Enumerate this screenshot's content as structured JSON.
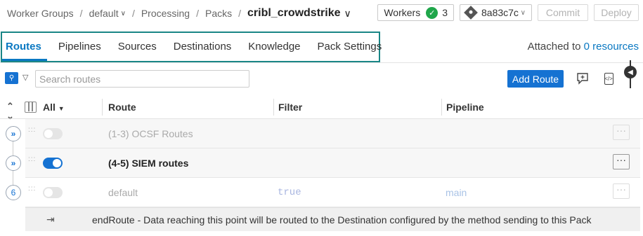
{
  "breadcrumb": {
    "items": [
      "Worker Groups",
      "default",
      "Processing",
      "Packs"
    ],
    "current": "cribl_crowdstrike",
    "separator": "/"
  },
  "header": {
    "workers_label": "Workers",
    "workers_count": "3",
    "commit_hash": "8a83c7c",
    "commit_button": "Commit",
    "deploy_button": "Deploy"
  },
  "tabs": [
    {
      "label": "Routes",
      "active": true
    },
    {
      "label": "Pipelines"
    },
    {
      "label": "Sources"
    },
    {
      "label": "Destinations"
    },
    {
      "label": "Knowledge"
    },
    {
      "label": "Pack Settings"
    }
  ],
  "attached": {
    "prefix": "Attached to",
    "link": "0 resources"
  },
  "search": {
    "placeholder": "Search routes"
  },
  "toolbar": {
    "add_route": "Add Route"
  },
  "table": {
    "headers": {
      "all": "All",
      "route": "Route",
      "filter": "Filter",
      "pipeline": "Pipeline"
    },
    "rows": [
      {
        "name": "(1-3) OCSF Routes",
        "enabled": false,
        "filter": "",
        "pipeline": "",
        "node": "»"
      },
      {
        "name": "(4-5) SIEM routes",
        "enabled": true,
        "filter": "",
        "pipeline": "",
        "node": "»"
      },
      {
        "name": "default",
        "enabled": false,
        "filter": "true",
        "pipeline": "main",
        "node": "6"
      }
    ],
    "end_route": "endRoute - Data reaching this point will be routed to the Destination configured by the method sending to this Pack"
  },
  "colors": {
    "accent": "#1572d2",
    "tab_outline": "#1a8686",
    "success": "#1fa64a"
  },
  "icons": [
    "search-icon",
    "filter-icon",
    "comment-icon",
    "code-icon",
    "preview-toggle-icon",
    "columns-icon",
    "expand-collapse-icon",
    "drag-handle-icon",
    "end-route-icon",
    "check-icon",
    "commit-icon"
  ]
}
